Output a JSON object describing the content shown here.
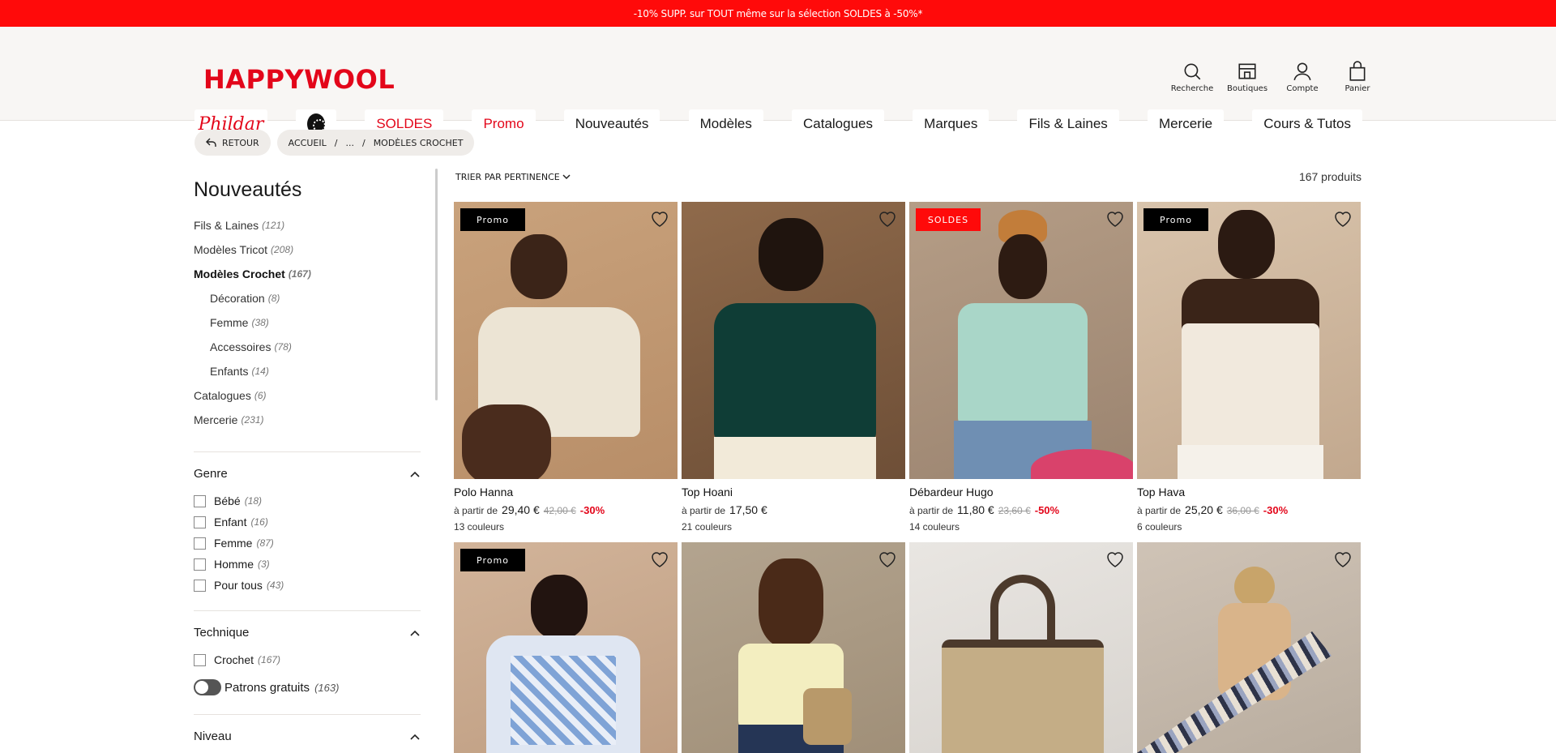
{
  "promo_bar": "-10% SUPP. sur TOUT même sur la sélection SOLDES à -50%*",
  "logo": "HAPPYWOOL",
  "header_actions": [
    {
      "label": "Recherche",
      "icon": "search-icon"
    },
    {
      "label": "Boutiques",
      "icon": "store-icon"
    },
    {
      "label": "Compte",
      "icon": "user-icon"
    },
    {
      "label": "Panier",
      "icon": "bag-icon"
    }
  ],
  "nav": {
    "phildar": "Phildar",
    "items": [
      "SOLDES",
      "Promo",
      "Nouveautés",
      "Modèles",
      "Catalogues",
      "Marques",
      "Fils & Laines",
      "Mercerie",
      "Cours & Tutos"
    ]
  },
  "breadcrumb": {
    "back": "RETOUR",
    "home": "ACCUEIL",
    "ellipsis": "...",
    "current": "MODÈLES CROCHET"
  },
  "sidebar": {
    "title": "Nouveautés",
    "categories": [
      {
        "label": "Fils & Laines",
        "count": "(121)"
      },
      {
        "label": "Modèles Tricot",
        "count": "(208)"
      },
      {
        "label": "Modèles Crochet",
        "count": "(167)"
      },
      {
        "label": "Décoration",
        "count": "(8)"
      },
      {
        "label": "Femme",
        "count": "(38)"
      },
      {
        "label": "Accessoires",
        "count": "(78)"
      },
      {
        "label": "Enfants",
        "count": "(14)"
      },
      {
        "label": "Catalogues",
        "count": "(6)"
      },
      {
        "label": "Mercerie",
        "count": "(231)"
      }
    ],
    "genre": {
      "title": "Genre",
      "options": [
        {
          "label": "Bébé",
          "count": "(18)"
        },
        {
          "label": "Enfant",
          "count": "(16)"
        },
        {
          "label": "Femme",
          "count": "(87)"
        },
        {
          "label": "Homme",
          "count": "(3)"
        },
        {
          "label": "Pour tous",
          "count": "(43)"
        }
      ]
    },
    "technique": {
      "title": "Technique",
      "options": [
        {
          "label": "Crochet",
          "count": "(167)"
        }
      ],
      "toggle": {
        "label": "Patrons gratuits",
        "count": "(163)"
      }
    },
    "niveau": {
      "title": "Niveau"
    }
  },
  "sort": {
    "label": "TRIER PAR PERTINENCE",
    "count": "167 produits"
  },
  "products": [
    {
      "badge": "Promo",
      "name": "Polo Hanna",
      "from": "à partir de",
      "price": "29,40 €",
      "old": "42,00 €",
      "discount": "-30%",
      "colors": "13 couleurs"
    },
    {
      "badge": "",
      "name": "Top Hoani",
      "from": "à partir de",
      "price": "17,50 €",
      "old": "",
      "discount": "",
      "colors": "21 couleurs"
    },
    {
      "badge": "SOLDES",
      "name": "Débardeur Hugo",
      "from": "à partir de",
      "price": "11,80 €",
      "old": "23,60 €",
      "discount": "-50%",
      "colors": "14 couleurs"
    },
    {
      "badge": "Promo",
      "name": "Top Hava",
      "from": "à partir de",
      "price": "25,20 €",
      "old": "36,00 €",
      "discount": "-30%",
      "colors": "6 couleurs"
    },
    {
      "badge": "Promo"
    },
    {
      "badge": ""
    },
    {
      "badge": ""
    },
    {
      "badge": ""
    }
  ],
  "colors": {
    "brand_red": "#e3061a",
    "promo_red": "#ff0a0a"
  }
}
